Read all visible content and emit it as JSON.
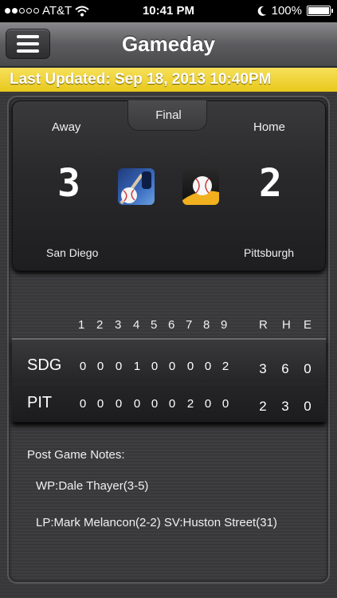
{
  "status_bar": {
    "carrier": "AT&T",
    "time": "10:41 PM",
    "battery": "100%",
    "signal_icon": "signal-dots-icon",
    "wifi_icon": "wifi-icon",
    "dnd_icon": "moon-icon",
    "battery_icon": "battery-icon"
  },
  "nav": {
    "title": "Gameday",
    "menu_icon": "hamburger-menu-icon"
  },
  "updated_text": "Last Updated: Sep 18, 2013 10:40PM",
  "game": {
    "status": "Final",
    "away": {
      "label": "Away",
      "score": "3",
      "city": "San Diego"
    },
    "home": {
      "label": "Home",
      "score": "2",
      "city": "Pittsburgh"
    }
  },
  "boxscore": {
    "innings": [
      "1",
      "2",
      "3",
      "4",
      "5",
      "6",
      "7",
      "8",
      "9"
    ],
    "totals_headers": [
      "R",
      "H",
      "E"
    ],
    "rows": [
      {
        "team": "SDG",
        "innings": [
          "0",
          "0",
          "0",
          "1",
          "0",
          "0",
          "0",
          "0",
          "2"
        ],
        "totals": [
          "3",
          "6",
          "0"
        ]
      },
      {
        "team": "PIT",
        "innings": [
          "0",
          "0",
          "0",
          "0",
          "0",
          "0",
          "2",
          "0",
          "0"
        ],
        "totals": [
          "2",
          "3",
          "0"
        ]
      }
    ]
  },
  "notes": {
    "title": "Post Game Notes:",
    "wp": "WP:Dale Thayer(3-5)",
    "lp_sv": "LP:Mark Melancon(2-2) SV:Huston Street(31)"
  },
  "colors": {
    "accent_yellow": "#f0d22c",
    "background": "#3a3a3c"
  }
}
